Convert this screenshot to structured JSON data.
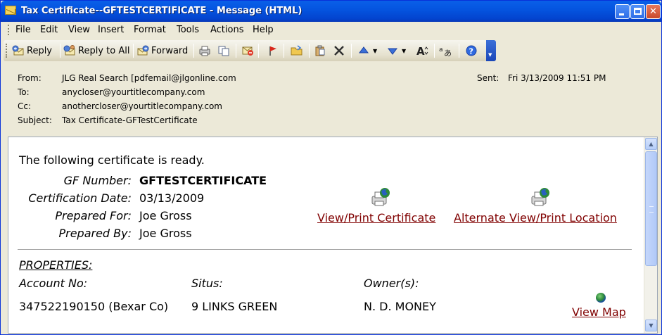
{
  "window": {
    "title": "Tax Certificate--GFTESTCERTIFICATE - Message (HTML)"
  },
  "menu": [
    "File",
    "Edit",
    "View",
    "Insert",
    "Format",
    "Tools",
    "Actions",
    "Help"
  ],
  "toolbar": {
    "reply": "Reply",
    "reply_all": "Reply to All",
    "forward": "Forward"
  },
  "header": {
    "from_label": "From:",
    "from_value": "JLG Real Search [pdfemail@jlgonline.com",
    "to_label": "To:",
    "to_value": "anycloser@yourtitlecompany.com",
    "cc_label": "Cc:",
    "cc_value": "anothercloser@yourtitlecompany.com",
    "subject_label": "Subject:",
    "subject_value": "Tax Certificate-GFTestCertificate",
    "sent_label": "Sent:",
    "sent_value": "Fri 3/13/2009 11:51 PM"
  },
  "body": {
    "intro": "The following certificate is ready.",
    "gf_label": "GF Number:",
    "gf_value": "GFTESTCERTIFICATE",
    "cert_date_label": "Certification Date:",
    "cert_date_value": "03/13/2009",
    "prepared_for_label": "Prepared For:",
    "prepared_for_value": "Joe Gross",
    "prepared_by_label": "Prepared By:",
    "prepared_by_value": "Joe Gross",
    "view_print_link": "View/Print Certificate",
    "alt_view_link": "Alternate View/Print Location",
    "properties_heading": "PROPERTIES:",
    "col_account": "Account No:",
    "col_situs": "Situs:",
    "col_owner": "Owner(s):",
    "account_value": "347522190150 (Bexar Co)",
    "situs_value": "9 LINKS GREEN",
    "owner_value": "N. D. MONEY",
    "view_map_link": "View Map"
  },
  "colors": {
    "titlebar": "#0555e0",
    "link": "#800000",
    "chrome": "#ece9d8"
  }
}
